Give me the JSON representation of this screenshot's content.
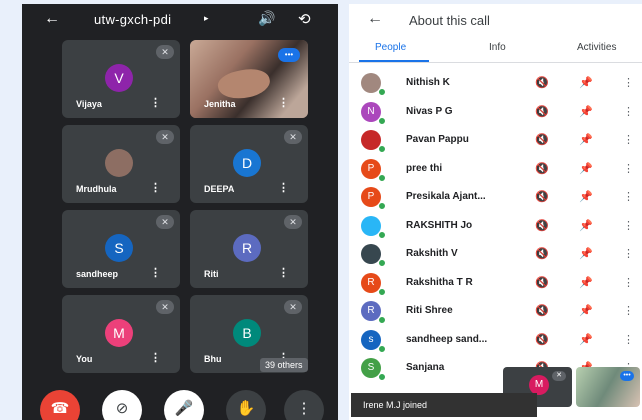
{
  "meeting": {
    "title": "utw-gxch-pdi",
    "caret": "▸",
    "back": "←",
    "speaker": "🔊",
    "switch_camera": "⟲",
    "tiles": [
      {
        "name": "Vijaya",
        "initial": "V",
        "color": "#8e24aa"
      },
      {
        "name": "Jenitha",
        "initial": "",
        "color": "",
        "photo": true
      },
      {
        "name": "Mrudhula",
        "initial": "",
        "color": "#8d6e63"
      },
      {
        "name": "DEEPA",
        "initial": "D",
        "color": "#1976d2"
      },
      {
        "name": "sandheep",
        "initial": "S",
        "color": "#1565c0"
      },
      {
        "name": "Riti",
        "initial": "R",
        "color": "#5c6bc0"
      },
      {
        "name": "You",
        "initial": "M",
        "color": "#ec407a"
      },
      {
        "name": "Bhu",
        "initial": "B",
        "color": "#00897b"
      }
    ],
    "others_label": "39 others",
    "controls": {
      "end_call": "☎",
      "camera_off": "⊘",
      "mic_off": "🎤",
      "raise_hand": "✋",
      "more": "⋮"
    }
  },
  "about": {
    "title": "About this call",
    "back": "←",
    "tabs": [
      "People",
      "Info",
      "Activities"
    ],
    "active_tab": "People",
    "participants": [
      {
        "name": "Nithish K",
        "initial": "",
        "color": "#a1887f"
      },
      {
        "name": "Nivas P G",
        "initial": "N",
        "color": "#ab47bc"
      },
      {
        "name": "Pavan Pappu",
        "initial": "",
        "color": "#c62828"
      },
      {
        "name": "pree thi",
        "initial": "P",
        "color": "#e64a19"
      },
      {
        "name": "Presikala Ajant...",
        "initial": "P",
        "color": "#e64a19"
      },
      {
        "name": "RAKSHITH Jo",
        "initial": "",
        "color": "#29b6f6"
      },
      {
        "name": "Rakshith V",
        "initial": "",
        "color": "#37474f"
      },
      {
        "name": "Rakshitha T R",
        "initial": "R",
        "color": "#e64a19"
      },
      {
        "name": "Riti Shree",
        "initial": "R",
        "color": "#5c6bc0"
      },
      {
        "name": "sandheep sand...",
        "initial": "s",
        "color": "#1565c0"
      },
      {
        "name": "Sanjana",
        "initial": "S",
        "color": "#43a047"
      }
    ],
    "icons": {
      "mute": "🔇",
      "pin": "📌",
      "more": "⋮"
    }
  },
  "snackbar": "Irene M.J joined",
  "self_view_initial": "M"
}
